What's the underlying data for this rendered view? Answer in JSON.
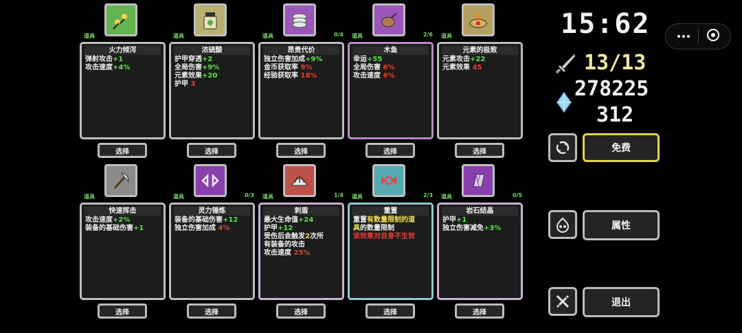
{
  "status": {
    "timer": "15:62",
    "attack": "13/13",
    "gold": "278225",
    "gems": "312"
  },
  "buttons": {
    "free": "免费",
    "attributes": "属性",
    "exit": "退出",
    "select": "选择"
  },
  "row1": [
    {
      "tag": "道具",
      "count": "",
      "title": "火力倾泻",
      "lines": [
        [
          "弹射攻击",
          [
            "+1",
            "g"
          ]
        ],
        [
          "攻击速度",
          [
            "+4%",
            "g"
          ]
        ]
      ]
    },
    {
      "tag": "道具",
      "count": "",
      "title": "浓硫酸",
      "lines": [
        [
          "护甲穿透",
          [
            "+2",
            "g"
          ]
        ],
        [
          "全局伤害",
          [
            "+9%",
            "g"
          ]
        ],
        [
          "元素效果",
          [
            "+20",
            "g"
          ]
        ],
        [
          "护甲 ",
          [
            "3",
            "r"
          ]
        ]
      ]
    },
    {
      "tag": "道具",
      "count": "0/4",
      "title": "昂贵代价",
      "lines": [
        [
          "独立伤害加成",
          [
            "+9%",
            "g"
          ]
        ],
        [
          "金币获取率 ",
          [
            "9%",
            "r"
          ]
        ],
        [
          "经验获取率 ",
          [
            "18%",
            "r"
          ]
        ]
      ]
    },
    {
      "tag": "道具",
      "count": "2/6",
      "title": "木鱼",
      "lines": [
        [
          "幸运",
          [
            "+55",
            "g"
          ]
        ],
        [
          "全局伤害 ",
          [
            "6%",
            "r"
          ]
        ],
        [
          "攻击速度 ",
          [
            "6%",
            "r"
          ]
        ]
      ]
    },
    {
      "tag": "道具",
      "count": "",
      "title": "元素的极致",
      "lines": [
        [
          "元素攻击",
          [
            "+22",
            "g"
          ]
        ],
        [
          "元素效果 ",
          [
            "45",
            "r"
          ]
        ]
      ]
    }
  ],
  "row2": [
    {
      "tag": "道具",
      "count": "",
      "title": "快速挥击",
      "lines": [
        [
          "攻击速度",
          [
            "+2%",
            "g"
          ]
        ],
        [
          "装备的基础伤害",
          [
            "+1",
            "g"
          ]
        ]
      ]
    },
    {
      "tag": "道具",
      "count": "0/3",
      "title": "灵力锤炼",
      "lines": [
        [
          "装备的基础伤害",
          [
            "+12",
            "g"
          ]
        ],
        [
          "独立伤害加成 ",
          [
            "4%",
            "r"
          ]
        ]
      ]
    },
    {
      "tag": "道具",
      "count": "1/4",
      "title": "刺盾",
      "lines": [
        [
          "最大生命值",
          [
            "+24",
            "g"
          ]
        ],
        [
          "护甲",
          [
            "+12",
            "g"
          ]
        ],
        [
          "受伤后会触发",
          [
            "2",
            "y"
          ],
          "次所"
        ],
        [
          "有装备的攻击"
        ],
        [
          "攻击速度 ",
          [
            "25%",
            "r"
          ]
        ]
      ]
    },
    {
      "tag": "道具",
      "count": "2/3",
      "title": "重置",
      "lines": [
        [
          "重置",
          [
            "有数量限制的道",
            "y"
          ]
        ],
        [
          [
            "具",
            "y"
          ],
          "的数量限制"
        ],
        [
          [
            "该效果对自身不生效",
            "r"
          ]
        ]
      ]
    },
    {
      "tag": "道具",
      "count": "0/5",
      "title": "岩石结晶",
      "lines": [
        [
          "护甲",
          [
            "+1",
            "g"
          ]
        ],
        [
          "独立伤害减免",
          [
            "+3%",
            "g"
          ]
        ]
      ]
    }
  ]
}
